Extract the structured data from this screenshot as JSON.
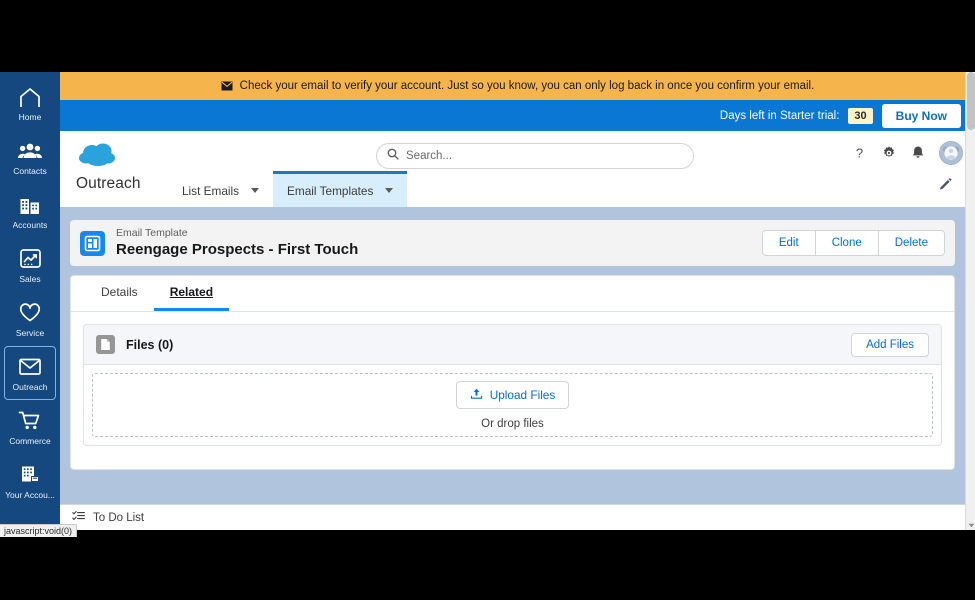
{
  "app_rail": {
    "items": [
      {
        "label": "Home",
        "icon": "home-icon",
        "selected": false
      },
      {
        "label": "Contacts",
        "icon": "contacts-icon",
        "selected": false
      },
      {
        "label": "Accounts",
        "icon": "accounts-icon",
        "selected": false
      },
      {
        "label": "Sales",
        "icon": "sales-chart-icon",
        "selected": false
      },
      {
        "label": "Service",
        "icon": "service-heart-icon",
        "selected": false
      },
      {
        "label": "Outreach",
        "icon": "outreach-envelope-icon",
        "selected": true
      },
      {
        "label": "Commerce",
        "icon": "commerce-cart-icon",
        "selected": false
      },
      {
        "label": "Your Accou...",
        "icon": "your-account-building-icon",
        "selected": false
      }
    ]
  },
  "verify_banner": {
    "icon": "envelope-icon",
    "message": "Check your email to verify your account. Just so you know, you can only log back in once you confirm your email."
  },
  "trial_bar": {
    "label": "Days left in Starter trial:",
    "days_left": "30",
    "buy_now_label": "Buy Now"
  },
  "header": {
    "logo_icon": "salesforce-cloud-logo",
    "app_name": "Outreach",
    "nav_tabs": [
      {
        "label": "List Emails",
        "active": false,
        "has_caret": true
      },
      {
        "label": "Email Templates",
        "active": true,
        "has_caret": true
      }
    ],
    "search": {
      "icon": "search-icon",
      "placeholder": "Search...",
      "value": ""
    },
    "actions": [
      {
        "name": "help-icon",
        "glyph": "?"
      },
      {
        "name": "setup-gear-icon",
        "glyph": "gear"
      },
      {
        "name": "notifications-bell-icon",
        "glyph": "bell"
      }
    ],
    "avatar": "user-avatar",
    "edit_pencil": "pencil-icon"
  },
  "record": {
    "icon": "email-template-record-icon",
    "type_label": "Email Template",
    "name": "Reengage Prospects - First Touch",
    "actions": [
      {
        "label": "Edit"
      },
      {
        "label": "Clone"
      },
      {
        "label": "Delete"
      }
    ]
  },
  "detail_tabs": [
    {
      "label": "Details",
      "active": false
    },
    {
      "label": "Related",
      "active": true
    }
  ],
  "files_card": {
    "icon": "file-document-icon",
    "title": "Files (0)",
    "add_files_label": "Add Files",
    "upload_icon": "upload-arrow-icon",
    "upload_label": "Upload Files",
    "drop_hint": "Or drop files"
  },
  "utility_bar": {
    "todo": {
      "icon": "todo-list-icon",
      "label": "To Do List"
    }
  },
  "status_tip": {
    "text": "javascript:void(0)"
  },
  "colors": {
    "rail_blue": "#14487f",
    "trial_blue": "#0b77d4",
    "banner_orange": "#f5b44c",
    "link_blue": "#0070d2",
    "accent_blue": "#1589ee",
    "page_bg": "#b0c4de",
    "badge_yellow": "#fcf4c8"
  }
}
